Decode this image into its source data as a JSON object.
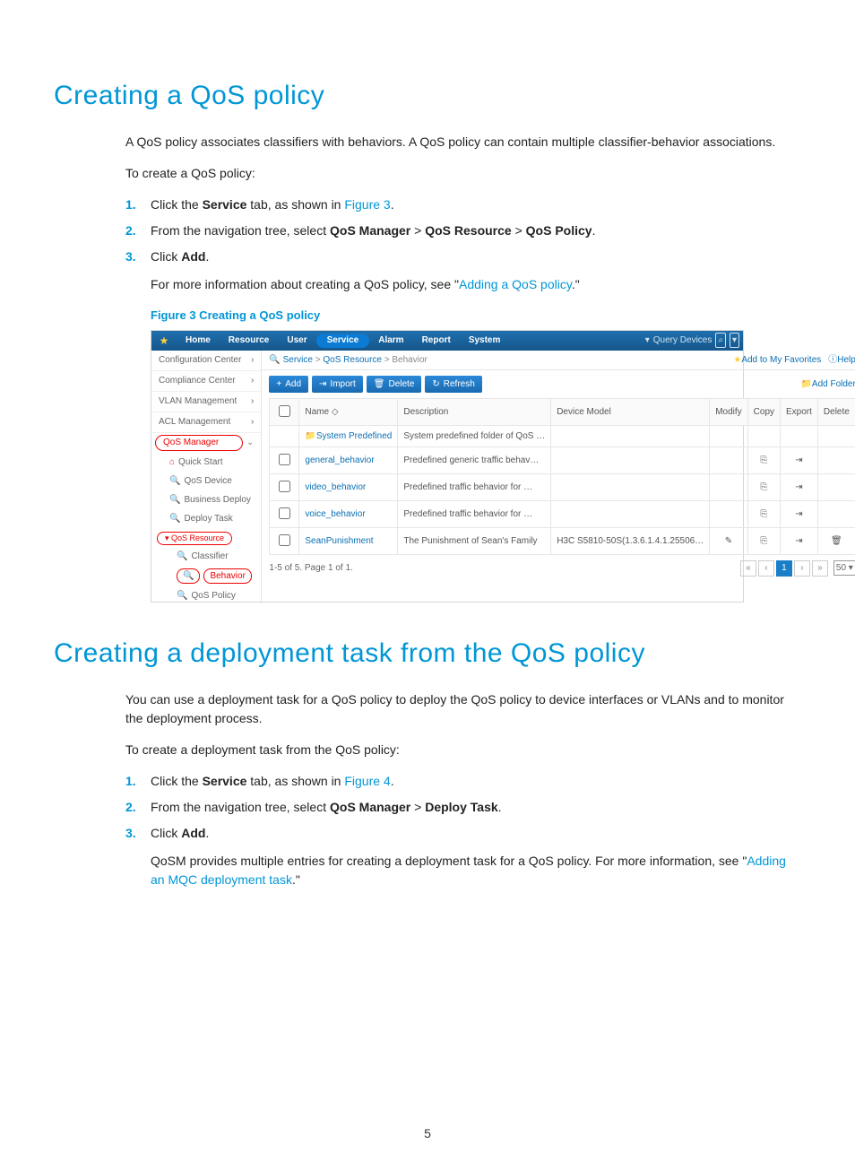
{
  "page_number": "5",
  "section1": {
    "heading": "Creating a QoS policy",
    "intro": "A QoS policy associates classifiers with behaviors. A QoS policy can contain multiple classifier-behavior associations.",
    "lead": "To create a QoS policy:",
    "steps": [
      {
        "n": "1.",
        "pre": "Click the ",
        "bold": "Service",
        "post": " tab, as shown in ",
        "link": "Figure 3",
        "after": "."
      },
      {
        "n": "2.",
        "pre": "From the navigation tree, select ",
        "bold": "QoS Manager",
        "sep1": " > ",
        "bold2": "QoS Resource",
        "sep2": " > ",
        "bold3": "QoS Policy",
        "after": "."
      },
      {
        "n": "3.",
        "pre": "Click ",
        "bold": "Add",
        "after": "."
      }
    ],
    "note_pre": "For more information about creating a QoS policy, see \"",
    "note_link": "Adding a QoS policy",
    "note_post": ".\"",
    "figure_caption": "Figure 3 Creating a QoS policy"
  },
  "screenshot": {
    "topnav": {
      "tabs": [
        "Home",
        "Resource",
        "User",
        "Service",
        "Alarm",
        "Report",
        "System"
      ],
      "active": "Service",
      "search_placeholder": "Query Devices"
    },
    "breadcrumb": {
      "icon_label": "Service",
      "mid": "QoS Resource",
      "last": "Behavior",
      "favorites": "Add to My Favorites",
      "help": "Help"
    },
    "sidepanel": {
      "items": [
        "Configuration Center",
        "Compliance Center",
        "VLAN Management",
        "ACL Management"
      ],
      "qos_manager": "QoS Manager",
      "sub": [
        "Quick Start",
        "QoS Device",
        "Business Deploy",
        "Deploy Task"
      ],
      "qos_resource": "QoS Resource",
      "resource_items": [
        "Classifier",
        "Behavior",
        "QoS Policy"
      ]
    },
    "toolbar": {
      "add": "Add",
      "import": "Import",
      "delete": "Delete",
      "refresh": "Refresh",
      "add_folder": "Add Folder"
    },
    "table": {
      "columns": [
        "",
        "Name ",
        "Description",
        "Device Model",
        "Modify",
        "Copy",
        "Export",
        "Delete"
      ],
      "sort_glyph": "◇",
      "rows": [
        {
          "name": "System Predefined",
          "desc": "System predefined folder of QoS …",
          "model": "",
          "modify": "",
          "copy": "",
          "export": "",
          "delete": "",
          "folder": true
        },
        {
          "name": "general_behavior",
          "desc": "Predefined generic traffic behav…",
          "model": "",
          "modify": "",
          "copy": "⎘",
          "export": "⇥",
          "delete": ""
        },
        {
          "name": "video_behavior",
          "desc": "Predefined traffic behavior for …",
          "model": "",
          "modify": "",
          "copy": "⎘",
          "export": "⇥",
          "delete": ""
        },
        {
          "name": "voice_behavior",
          "desc": "Predefined traffic behavior for …",
          "model": "",
          "modify": "",
          "copy": "⎘",
          "export": "⇥",
          "delete": ""
        },
        {
          "name": "SeanPunishment",
          "desc": "The Punishment of Sean's Family",
          "model": "H3C S5810-50S(1.3.6.1.4.1.25506…",
          "modify": "✎",
          "copy": "⎘",
          "export": "⇥",
          "delete": "🗑"
        }
      ]
    },
    "pager": {
      "summary": "1-5 of 5. Page 1 of 1.",
      "page_size": "50"
    }
  },
  "section2": {
    "heading": "Creating a deployment task from the QoS policy",
    "intro": "You can use a deployment task for a QoS policy to deploy the QoS policy to device interfaces or VLANs and to monitor the deployment process.",
    "lead": "To create a deployment task from the QoS policy:",
    "steps": [
      {
        "n": "1.",
        "pre": "Click the ",
        "bold": "Service",
        "post": " tab, as shown in ",
        "link": "Figure 4",
        "after": "."
      },
      {
        "n": "2.",
        "pre": "From the navigation tree, select ",
        "bold": "QoS Manager",
        "sep1": " > ",
        "bold2": "Deploy Task",
        "after": "."
      },
      {
        "n": "3.",
        "pre": "Click ",
        "bold": "Add",
        "after": "."
      }
    ],
    "note_pre": "QoSM provides multiple entries for creating a deployment task for a QoS policy. For more information, see \"",
    "note_link": "Adding an MQC deployment task",
    "note_post": ".\""
  }
}
